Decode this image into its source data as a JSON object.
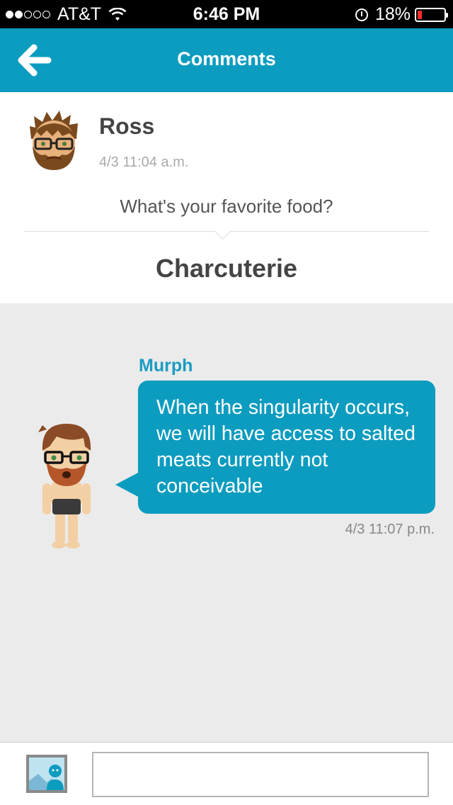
{
  "status_bar": {
    "carrier": "AT&T",
    "time": "6:46 PM",
    "battery_percent": "18%",
    "battery_level": 0.18,
    "signal_bars_filled": 2,
    "signal_bars_total": 5
  },
  "header": {
    "title": "Comments",
    "background_color": "#0c9cc0"
  },
  "post": {
    "author": "Ross",
    "timestamp": "4/3 11:04 a.m.",
    "question": "What's your favorite food?",
    "answer": "Charcuterie"
  },
  "comment": {
    "author": "Murph",
    "text": "When the singularity occurs, we will have access to salted meats currently not conceivable",
    "timestamp": "4/3 11:07 p.m.",
    "bubble_color": "#0c9cc0"
  },
  "composer": {
    "input_value": "",
    "image_icon": "image-icon"
  }
}
